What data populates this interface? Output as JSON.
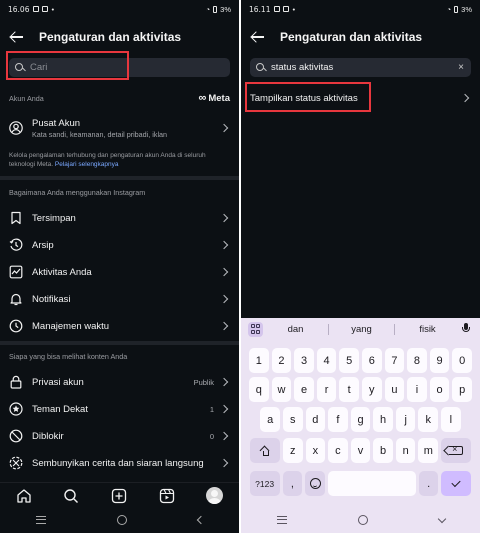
{
  "left": {
    "status": {
      "time": "16.06",
      "battery": "3%"
    },
    "header": {
      "title": "Pengaturan dan aktivitas"
    },
    "search": {
      "placeholder": "Cari"
    },
    "account_section": {
      "label": "Akun Anda",
      "brand": "Meta"
    },
    "account_center": {
      "title": "Pusat Akun",
      "subtitle": "Kata sandi, keamanan, detail pribadi, iklan"
    },
    "note": {
      "text": "Kelola pengalaman terhubung dan pengaturan akun Anda di seluruh teknologi Meta.",
      "link": "Pelajari selengkapnya"
    },
    "usage_section": {
      "label": "Bagaimana Anda menggunakan Instagram"
    },
    "usage_items": [
      {
        "label": "Tersimpan",
        "icon": "bookmark-icon"
      },
      {
        "label": "Arsip",
        "icon": "archive-icon"
      },
      {
        "label": "Aktivitas Anda",
        "icon": "activity-icon"
      },
      {
        "label": "Notifikasi",
        "icon": "bell-icon"
      },
      {
        "label": "Manajemen waktu",
        "icon": "clock-icon"
      }
    ],
    "visibility_section": {
      "label": "Siapa yang bisa melihat konten Anda"
    },
    "visibility_items": [
      {
        "label": "Privasi akun",
        "value": "Publik",
        "icon": "lock-icon"
      },
      {
        "label": "Teman Dekat",
        "value": "1",
        "icon": "star-icon"
      },
      {
        "label": "Diblokir",
        "value": "0",
        "icon": "block-icon"
      },
      {
        "label": "Sembunyikan cerita dan siaran langsung",
        "value": "",
        "icon": "hide-story-icon"
      }
    ],
    "bottom_nav": [
      "home-icon",
      "search-icon",
      "create-icon",
      "reels-icon",
      "profile-avatar"
    ]
  },
  "right": {
    "status": {
      "time": "16.11",
      "battery": "3%"
    },
    "header": {
      "title": "Pengaturan dan aktivitas"
    },
    "search": {
      "value": "status aktivitas"
    },
    "result": {
      "label": "Tampilkan status aktivitas"
    },
    "keyboard": {
      "suggestions": [
        "dan",
        "yang",
        "fisik"
      ],
      "row_numbers": [
        "1",
        "2",
        "3",
        "4",
        "5",
        "6",
        "7",
        "8",
        "9",
        "0"
      ],
      "row1": [
        "q",
        "w",
        "e",
        "r",
        "t",
        "y",
        "u",
        "i",
        "o",
        "p"
      ],
      "row2": [
        "a",
        "s",
        "d",
        "f",
        "g",
        "h",
        "j",
        "k",
        "l"
      ],
      "row3": [
        "z",
        "x",
        "c",
        "v",
        "b",
        "n",
        "m"
      ],
      "symbols_key": "?123",
      "comma": ",",
      "period": "."
    }
  },
  "colors": {
    "background": "#0c1014",
    "highlight": "#e8373e",
    "keyboard": "#ebe3f3",
    "link": "#7aa8ff"
  }
}
